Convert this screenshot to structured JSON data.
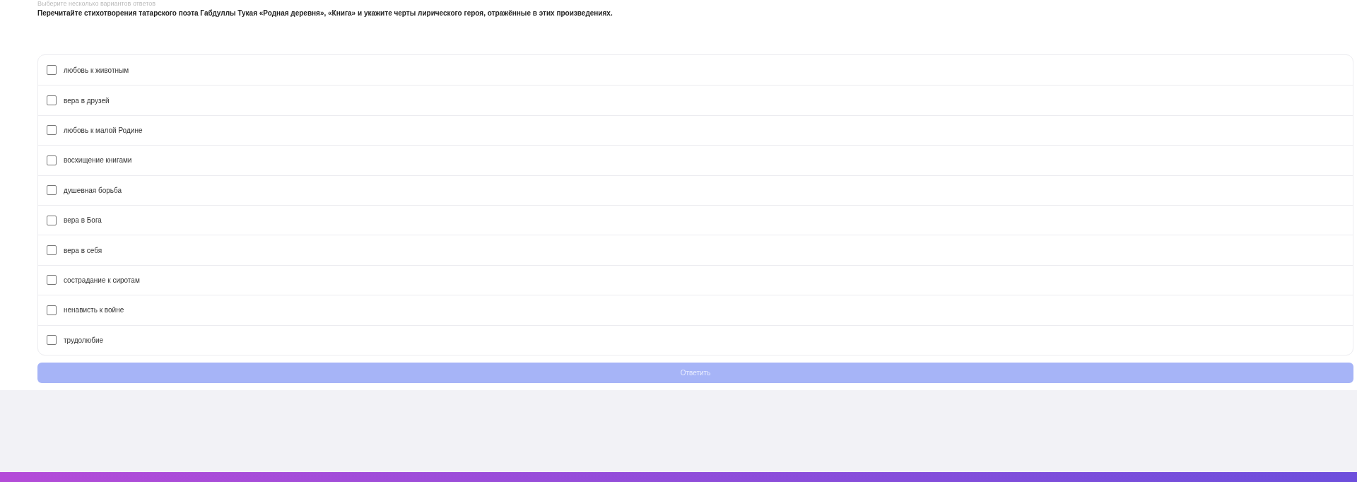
{
  "hint": "Выберите несколько вариантов ответов",
  "question": "Перечитайте стихотворения татарского поэта Габдуллы Тукая «Родная деревня», «Книга» и укажите черты лирического героя, отражённые в этих произведениях.",
  "options": [
    {
      "label": "любовь к животным",
      "checked": false
    },
    {
      "label": "вера в друзей",
      "checked": false
    },
    {
      "label": "любовь к малой Родине",
      "checked": false
    },
    {
      "label": "восхищение книгами",
      "checked": false
    },
    {
      "label": "душевная борьба",
      "checked": false
    },
    {
      "label": "вера в Бога",
      "checked": false
    },
    {
      "label": "вера в себя",
      "checked": false
    },
    {
      "label": "сострадание к сиротам",
      "checked": false
    },
    {
      "label": "ненависть к войне",
      "checked": false
    },
    {
      "label": "трудолюбие",
      "checked": false
    }
  ],
  "submit": {
    "label": "Ответить",
    "disabled": true
  }
}
